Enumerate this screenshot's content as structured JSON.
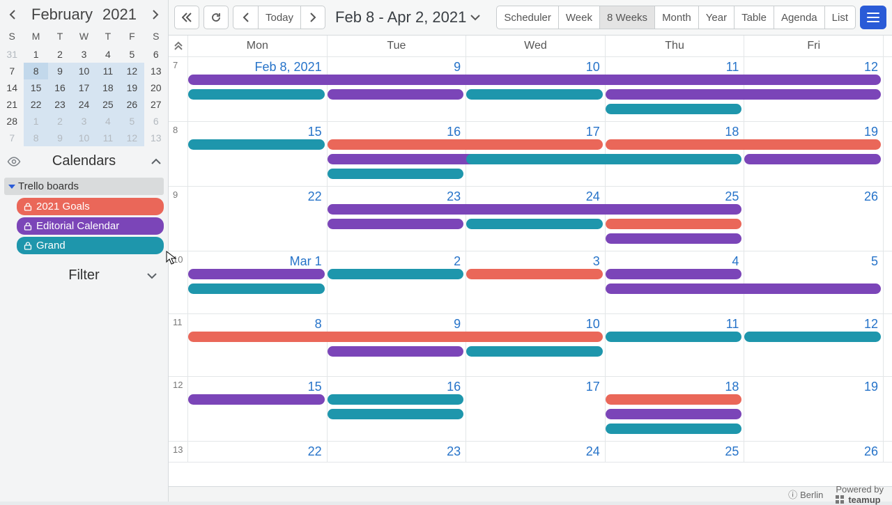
{
  "colors": {
    "red": "#ea6759",
    "purple": "#7b45b8",
    "teal": "#1e96ac"
  },
  "miniCal": {
    "month": "February",
    "year": "2021",
    "dow": [
      "S",
      "M",
      "T",
      "W",
      "T",
      "F",
      "S"
    ],
    "days": [
      [
        {
          "n": "31",
          "dim": true
        },
        {
          "n": "1"
        },
        {
          "n": "2"
        },
        {
          "n": "3"
        },
        {
          "n": "4"
        },
        {
          "n": "5"
        },
        {
          "n": "6"
        }
      ],
      [
        {
          "n": "7"
        },
        {
          "n": "8",
          "sel": "sel"
        },
        {
          "n": "9",
          "sel": "range"
        },
        {
          "n": "10",
          "sel": "range"
        },
        {
          "n": "11",
          "sel": "range"
        },
        {
          "n": "12",
          "sel": "range"
        },
        {
          "n": "13"
        }
      ],
      [
        {
          "n": "14"
        },
        {
          "n": "15",
          "sel": "range"
        },
        {
          "n": "16",
          "sel": "range"
        },
        {
          "n": "17",
          "sel": "range"
        },
        {
          "n": "18",
          "sel": "range"
        },
        {
          "n": "19",
          "sel": "range"
        },
        {
          "n": "20"
        }
      ],
      [
        {
          "n": "21"
        },
        {
          "n": "22",
          "sel": "range"
        },
        {
          "n": "23",
          "sel": "range"
        },
        {
          "n": "24",
          "sel": "range"
        },
        {
          "n": "25",
          "sel": "range"
        },
        {
          "n": "26",
          "sel": "range"
        },
        {
          "n": "27"
        }
      ],
      [
        {
          "n": "28"
        },
        {
          "n": "1",
          "dim": true,
          "sel": "range"
        },
        {
          "n": "2",
          "dim": true,
          "sel": "range"
        },
        {
          "n": "3",
          "dim": true,
          "sel": "range"
        },
        {
          "n": "4",
          "dim": true,
          "sel": "range"
        },
        {
          "n": "5",
          "dim": true,
          "sel": "range"
        },
        {
          "n": "6",
          "dim": true
        }
      ],
      [
        {
          "n": "7",
          "dim": true
        },
        {
          "n": "8",
          "dim": true,
          "sel": "range"
        },
        {
          "n": "9",
          "dim": true,
          "sel": "range"
        },
        {
          "n": "10",
          "dim": true,
          "sel": "range"
        },
        {
          "n": "11",
          "dim": true,
          "sel": "range"
        },
        {
          "n": "12",
          "dim": true,
          "sel": "range"
        },
        {
          "n": "13",
          "dim": true
        }
      ]
    ]
  },
  "sidebar": {
    "title": "Calendars",
    "group": "Trello boards",
    "items": [
      {
        "label": "2021 Goals",
        "color": "#ea6759"
      },
      {
        "label": "Editorial Calendar",
        "color": "#7b45b8"
      },
      {
        "label": "Grand",
        "color": "#1e96ac"
      }
    ],
    "filter": "Filter"
  },
  "toolbar": {
    "today": "Today",
    "range": "Feb 8 - Apr 2, 2021",
    "views": [
      "Scheduler",
      "Week",
      "8 Weeks",
      "Month",
      "Year",
      "Table",
      "Agenda",
      "List"
    ],
    "activeView": "8 Weeks"
  },
  "weekdays": [
    "Mon",
    "Tue",
    "Wed",
    "Thu",
    "Fri"
  ],
  "rows": [
    {
      "wk": "7",
      "nums": [
        "Feb 8, 2021",
        "9",
        "10",
        "11",
        "12"
      ],
      "bars": [
        {
          "c": "purple",
          "s": 0,
          "e": 5,
          "y": 0
        },
        {
          "c": "teal",
          "s": 0,
          "e": 1,
          "y": 1
        },
        {
          "c": "purple",
          "s": 1,
          "e": 2,
          "y": 1
        },
        {
          "c": "teal",
          "s": 2,
          "e": 3,
          "y": 1
        },
        {
          "c": "purple",
          "s": 3,
          "e": 5,
          "y": 1
        },
        {
          "c": "teal",
          "s": 3,
          "e": 4,
          "y": 2
        }
      ]
    },
    {
      "wk": "8",
      "nums": [
        "15",
        "16",
        "17",
        "18",
        "19"
      ],
      "bars": [
        {
          "c": "teal",
          "s": 0,
          "e": 1,
          "y": 0
        },
        {
          "c": "red",
          "s": 1,
          "e": 3,
          "y": 0
        },
        {
          "c": "red",
          "s": 3,
          "e": 5,
          "y": 0
        },
        {
          "c": "purple",
          "s": 1,
          "e": 3,
          "y": 1
        },
        {
          "c": "teal",
          "s": 2,
          "e": 4,
          "y": 1
        },
        {
          "c": "purple",
          "s": 4,
          "e": 5,
          "y": 1
        },
        {
          "c": "teal",
          "s": 1,
          "e": 2,
          "y": 2
        }
      ]
    },
    {
      "wk": "9",
      "nums": [
        "22",
        "23",
        "24",
        "25",
        "26"
      ],
      "bars": [
        {
          "c": "purple",
          "s": 1,
          "e": 4,
          "y": 0
        },
        {
          "c": "purple",
          "s": 1,
          "e": 2,
          "y": 1
        },
        {
          "c": "teal",
          "s": 2,
          "e": 3,
          "y": 1
        },
        {
          "c": "red",
          "s": 3,
          "e": 4,
          "y": 1
        },
        {
          "c": "purple",
          "s": 3,
          "e": 4,
          "y": 2
        }
      ]
    },
    {
      "wk": "10",
      "nums": [
        "Mar 1",
        "2",
        "3",
        "4",
        "5"
      ],
      "bars": [
        {
          "c": "purple",
          "s": 0,
          "e": 1,
          "y": 0
        },
        {
          "c": "teal",
          "s": 1,
          "e": 2,
          "y": 0
        },
        {
          "c": "red",
          "s": 2,
          "e": 3,
          "y": 0
        },
        {
          "c": "purple",
          "s": 3,
          "e": 4,
          "y": 0
        },
        {
          "c": "teal",
          "s": 0,
          "e": 1,
          "y": 1
        },
        {
          "c": "purple",
          "s": 3,
          "e": 5,
          "y": 1
        }
      ]
    },
    {
      "wk": "11",
      "nums": [
        "8",
        "9",
        "10",
        "11",
        "12"
      ],
      "bars": [
        {
          "c": "red",
          "s": 0,
          "e": 3,
          "y": 0
        },
        {
          "c": "teal",
          "s": 3,
          "e": 4,
          "y": 0
        },
        {
          "c": "teal",
          "s": 4,
          "e": 5,
          "y": 0
        },
        {
          "c": "purple",
          "s": 1,
          "e": 2,
          "y": 1
        },
        {
          "c": "teal",
          "s": 2,
          "e": 3,
          "y": 1
        }
      ]
    },
    {
      "wk": "12",
      "nums": [
        "15",
        "16",
        "17",
        "18",
        "19"
      ],
      "bars": [
        {
          "c": "purple",
          "s": 0,
          "e": 1,
          "y": 0
        },
        {
          "c": "teal",
          "s": 1,
          "e": 2,
          "y": 0
        },
        {
          "c": "red",
          "s": 3,
          "e": 4,
          "y": 0
        },
        {
          "c": "teal",
          "s": 1,
          "e": 2,
          "y": 1
        },
        {
          "c": "purple",
          "s": 3,
          "e": 4,
          "y": 1
        },
        {
          "c": "teal",
          "s": 3,
          "e": 4,
          "y": 2
        }
      ]
    },
    {
      "wk": "13",
      "nums": [
        "22",
        "23",
        "24",
        "25",
        "26"
      ],
      "bars": [],
      "short": true
    }
  ],
  "footer": {
    "tz": "Berlin",
    "powered": "Powered by",
    "brand": "teamup"
  }
}
